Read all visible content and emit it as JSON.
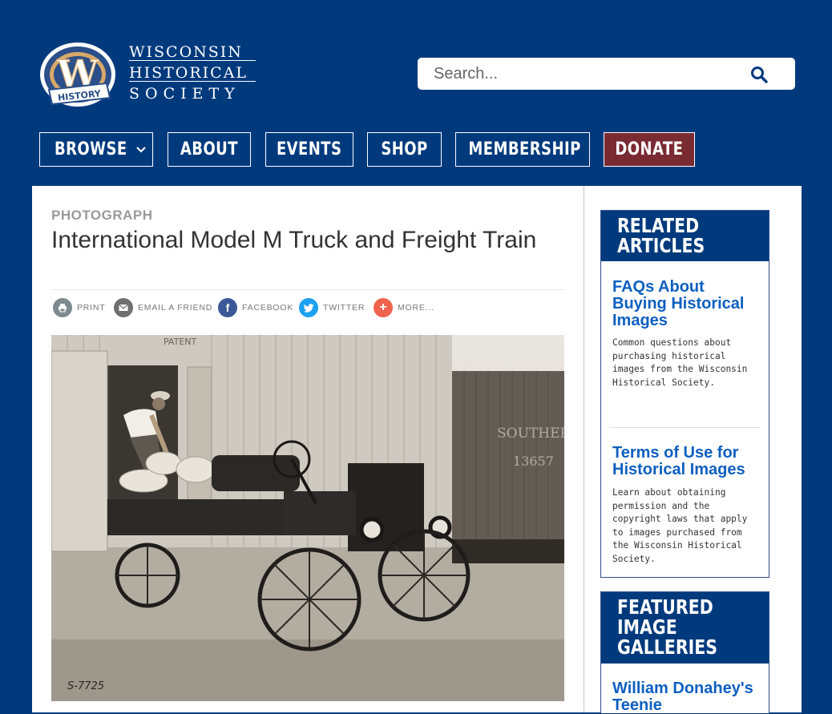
{
  "brand": {
    "logo_letter": "W",
    "logo_ribbon": "HISTORY",
    "name_lines": [
      "WISCONSIN",
      "HISTORICAL",
      "SOCIETY"
    ]
  },
  "search": {
    "placeholder": "Search...",
    "icon": "search-icon"
  },
  "nav": {
    "items": [
      {
        "label": "BROWSE",
        "has_dropdown": true,
        "icon": "chevron-down-icon"
      },
      {
        "label": "ABOUT"
      },
      {
        "label": "EVENTS"
      },
      {
        "label": "SHOP"
      },
      {
        "label": "MEMBERSHIP"
      },
      {
        "label": "DONATE",
        "color": "#7a2a31"
      }
    ]
  },
  "article": {
    "type_label": "PHOTOGRAPH",
    "title": "International Model M Truck and Freight Train",
    "share": [
      {
        "label": "PRINT",
        "icon": "printer-icon",
        "color": "#7d8a8f"
      },
      {
        "label": "EMAIL A FRIEND",
        "icon": "email-icon",
        "color": "#6f6f6f"
      },
      {
        "label": "FACEBOOK",
        "icon": "facebook-icon",
        "color": "#3b5998"
      },
      {
        "label": "TWITTER",
        "icon": "twitter-icon",
        "color": "#1da1f2"
      },
      {
        "label": "MORE...",
        "icon": "plus-icon",
        "color": "#f0634f"
      }
    ],
    "photo": {
      "boxcar_text": "PATENT",
      "car_text": "SOUTHERN",
      "car_number": "13657",
      "negative_number": "S-7725"
    }
  },
  "sidebar": {
    "related": {
      "heading": [
        "RELATED",
        "ARTICLES"
      ],
      "items": [
        {
          "title": "FAQs About Buying Historical Images",
          "desc": "Common questions about purchasing historical images from the Wisconsin Historical Society."
        },
        {
          "title": "Terms of Use for Historical Images",
          "desc": "Learn about obtaining permission and the copyright laws that apply to images purchased from the Wisconsin Historical Society."
        }
      ]
    },
    "featured": {
      "heading": [
        "FEATURED",
        "IMAGE",
        "GALLERIES"
      ],
      "items": [
        {
          "title": "William Donahey's Teenie"
        }
      ]
    }
  },
  "colors": {
    "background": "#003a7d",
    "donate": "#7a2a31",
    "link": "#0d5fc0"
  }
}
